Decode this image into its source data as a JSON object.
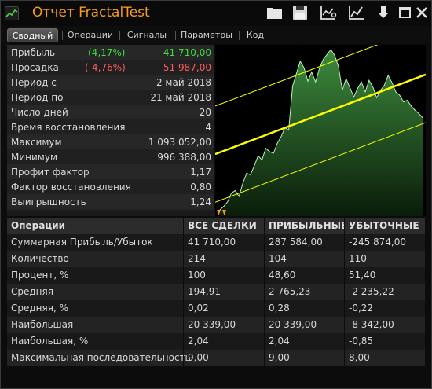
{
  "window": {
    "title": "Отчет FractalTest",
    "icons": [
      "app-icon",
      "folder-icon",
      "save-icon",
      "chart-settings-icon",
      "line-chart-icon",
      "export-icon",
      "minimize-icon",
      "close-icon"
    ]
  },
  "tabs": [
    {
      "label": "Сводный",
      "active": true
    },
    {
      "label": "Операции",
      "active": false
    },
    {
      "label": "Сигналы",
      "active": false
    },
    {
      "label": "Параметры",
      "active": false
    },
    {
      "label": "Код",
      "active": false
    }
  ],
  "summary": [
    {
      "label": "Прибыль",
      "pct": "(4,17%)",
      "value": "41 710,00",
      "tone": "green"
    },
    {
      "label": "Просадка",
      "pct": "(-4,76%)",
      "value": "-51 987,00",
      "tone": "red"
    },
    {
      "label": "Период с",
      "pct": "",
      "value": "2 май 2018",
      "tone": ""
    },
    {
      "label": "Период по",
      "pct": "",
      "value": "21 май 2018",
      "tone": ""
    },
    {
      "label": "Число дней",
      "pct": "",
      "value": "20",
      "tone": ""
    },
    {
      "label": "Время восстановления",
      "pct": "",
      "value": "4",
      "tone": ""
    },
    {
      "label": "Максимум",
      "pct": "",
      "value": "1 093 052,00",
      "tone": ""
    },
    {
      "label": "Минимум",
      "pct": "",
      "value": "996 388,00",
      "tone": ""
    },
    {
      "label": "Профит фактор",
      "pct": "",
      "value": "1,17",
      "tone": ""
    },
    {
      "label": "Фактор восстановления",
      "pct": "",
      "value": "0,80",
      "tone": ""
    },
    {
      "label": "Выигрышность",
      "pct": "",
      "value": "1,24",
      "tone": ""
    }
  ],
  "stats": {
    "headers": [
      "Операции",
      "ВСЕ СДЕЛКИ",
      "ПРИБЫЛЬНЫЕ",
      "УБЫТОЧНЫЕ"
    ],
    "rows": [
      [
        "Суммарная Прибыль/Убыток",
        "41 710,00",
        "287 584,00",
        "-245 874,00"
      ],
      [
        "Количество",
        "214",
        "104",
        "110"
      ],
      [
        "Процент, %",
        "100",
        "48,60",
        "51,40"
      ],
      [
        "Средняя",
        "194,91",
        "2 765,23",
        "-2 235,22"
      ],
      [
        "Средняя, %",
        "0,02",
        "0,28",
        "-0,22"
      ],
      [
        "Наибольшая",
        "20 339,00",
        "20 339,00",
        "-8 342,00"
      ],
      [
        "Наибольшая, %",
        "2,04",
        "2,04",
        "-0,85"
      ],
      [
        "Максимальная последовательность",
        "9,00",
        "9,00",
        "8,00"
      ]
    ]
  },
  "chart_data": {
    "type": "area",
    "description_series": "equity",
    "ylim": [
      996388,
      1093052
    ],
    "series": [
      {
        "values": [
          996388,
          998500,
          1001200,
          1006500,
          1008000,
          1004500,
          1012500,
          1018500,
          1017500,
          1023000,
          1029000,
          1026500,
          1033500,
          1031500,
          1030500,
          1036500,
          1040500,
          1046000,
          1044500,
          1071000,
          1078500,
          1086000,
          1082000,
          1074000,
          1079500,
          1073500,
          1081500,
          1087000,
          1090000,
          1093052,
          1089500,
          1083000,
          1068500,
          1075500,
          1070000,
          1064500,
          1069500,
          1073500,
          1067500,
          1074500,
          1070500,
          1064000,
          1068500,
          1071500,
          1077500,
          1073000,
          1067500,
          1065500,
          1061500,
          1062500,
          1059000,
          1056500,
          1054500,
          1052000
        ]
      }
    ],
    "trend_lines": [
      {
        "role": "center",
        "start": 1030000,
        "end": 1078000
      },
      {
        "role": "upper",
        "start": 1059000,
        "end": 1107000
      },
      {
        "role": "lower",
        "start": 1001000,
        "end": 1049000
      }
    ],
    "markers": [
      "entry",
      "entry"
    ],
    "grid": false,
    "legend": "none"
  },
  "colors": {
    "accent": "#f59b1f",
    "positive": "#3cde3c",
    "negative": "#ff5b5b",
    "channel": "#ffff00",
    "equity_fill": "#2f6b2f",
    "equity_line": "#b8f5b8"
  }
}
